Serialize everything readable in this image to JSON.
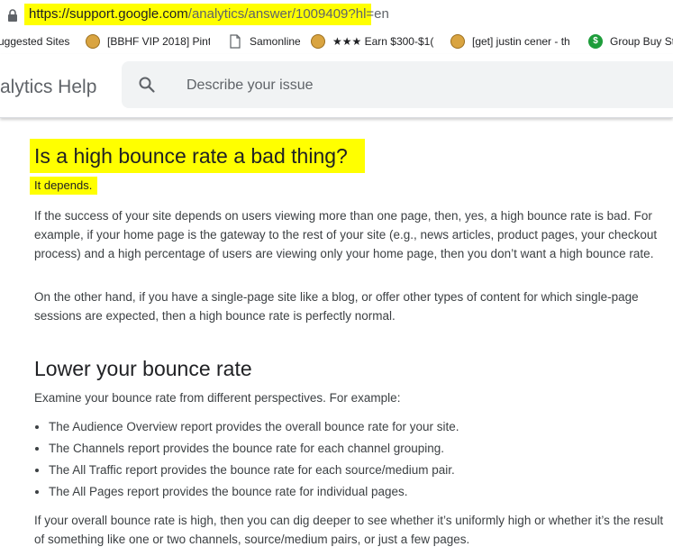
{
  "url": {
    "host": "https://support.google.com",
    "path": "/analytics/answer/1009409?hl=en"
  },
  "bookmarks": [
    {
      "label": "uggested Sites",
      "icon": "none"
    },
    {
      "label": "[BBHF VIP 2018] Pint",
      "icon": "gold-coin-icon"
    },
    {
      "label": "Samonline",
      "icon": "page-icon"
    },
    {
      "label": "★★★ Earn $300-$1(",
      "icon": "gold-coin-icon"
    },
    {
      "label": "[get] justin cener - th",
      "icon": "gold-coin-icon"
    },
    {
      "label": "Group Buy St",
      "icon": "dollar-icon"
    }
  ],
  "header": {
    "brand": "alytics Help",
    "search_placeholder": "Describe your issue"
  },
  "article": {
    "title": "Is a high bounce rate a bad thing?",
    "short_answer": "It depends.",
    "para1": "If the success of your site depends on users viewing more than one page, then, yes, a high bounce rate is bad. For example, if your home page is the gateway to the rest of your site (e.g., news articles, product pages, your checkout process) and a high percentage of users are viewing only your home page, then you don’t want a high bounce rate.",
    "para2": "On the other hand, if you have a single-page site like a blog, or offer other types of content for which single-page sessions are expected, then a high bounce rate is perfectly normal.",
    "section_title": "Lower your bounce rate",
    "intro": "Examine your bounce rate from different perspectives. For example:",
    "items": [
      "The Audience Overview report provides the overall bounce rate for your site.",
      "The Channels report provides the bounce rate for each channel grouping.",
      "The All Traffic report provides the bounce rate for each source/medium pair.",
      "The All Pages report provides the bounce rate for individual pages."
    ],
    "closing": "If your overall bounce rate is high, then you can dig deeper to see whether it’s uniformly high or whether it’s the result of something like one or two channels, source/medium pairs, or just a few pages."
  },
  "colors": {
    "highlight": "#ffff00",
    "text": "#202124",
    "body_text": "#3c4043",
    "search_bg": "#f1f3f4"
  }
}
